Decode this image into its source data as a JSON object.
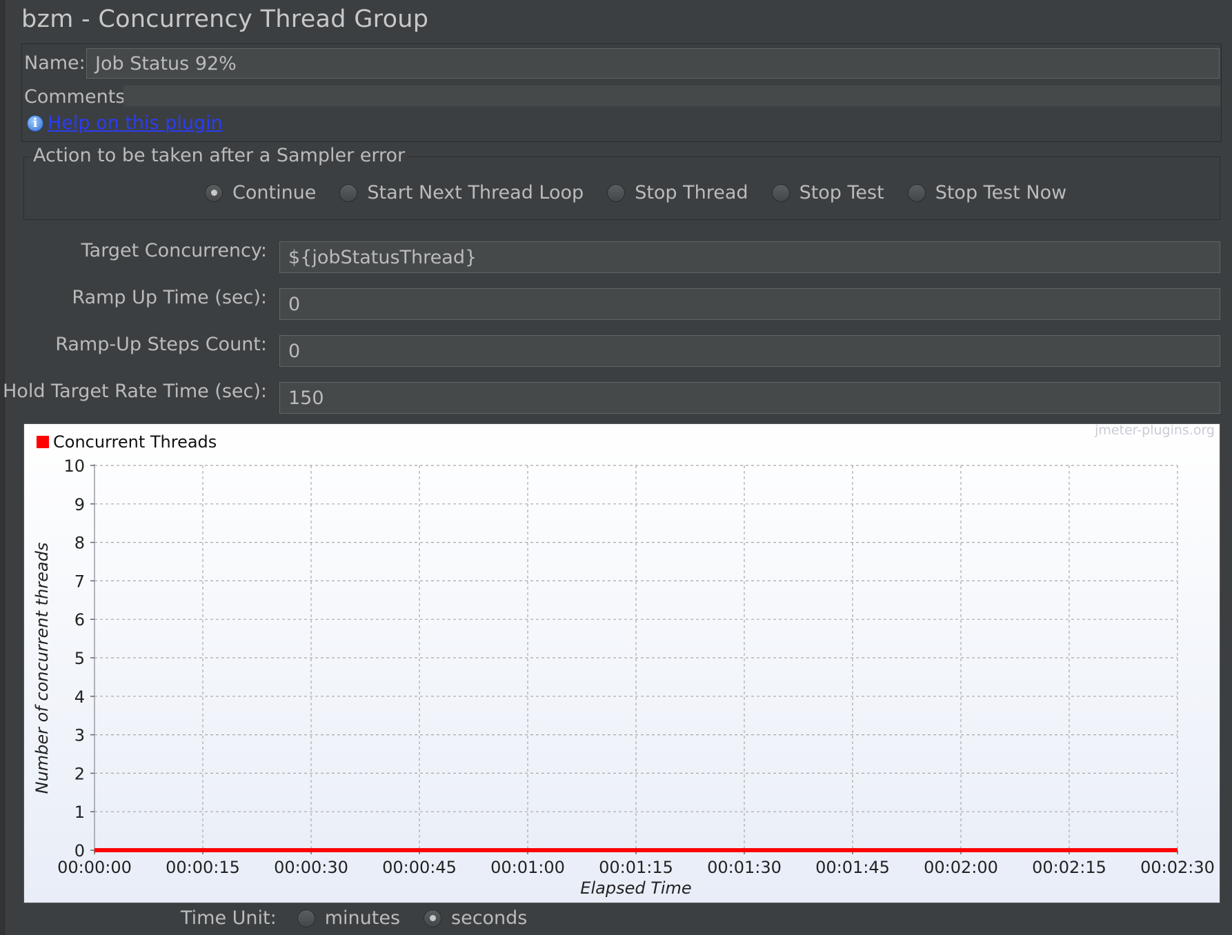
{
  "title": "bzm - Concurrency Thread Group",
  "name_label": "Name:",
  "name_value": "Job Status 92%",
  "comments_label": "Comments:",
  "comments_value": "",
  "help_link": "Help on this plugin",
  "error_action": {
    "legend": "Action to be taken after a Sampler error",
    "options": [
      "Continue",
      "Start Next Thread Loop",
      "Stop Thread",
      "Stop Test",
      "Stop Test Now"
    ],
    "selected": "Continue"
  },
  "form": {
    "target_concurrency": {
      "label": "Target Concurrency:",
      "value": "${jobStatusThread}"
    },
    "ramp_up_time": {
      "label": "Ramp Up Time (sec):",
      "value": "0"
    },
    "ramp_up_steps": {
      "label": "Ramp-Up Steps Count:",
      "value": "0"
    },
    "hold_time": {
      "label": "Hold Target Rate Time (sec):",
      "value": "150"
    }
  },
  "time_unit": {
    "label": "Time Unit:",
    "options": [
      "minutes",
      "seconds"
    ],
    "selected": "seconds"
  },
  "colors": {
    "series": "#ff0000",
    "background": "#3c3f41",
    "link": "#2a3cf5"
  },
  "chart_data": {
    "type": "line",
    "watermark": "jmeter-plugins.org",
    "legend": {
      "position": "top-left",
      "entries": [
        "Concurrent Threads"
      ]
    },
    "xlabel": "Elapsed Time",
    "ylabel": "Number of concurrent threads",
    "xticks": [
      "00:00:00",
      "00:00:15",
      "00:00:30",
      "00:00:45",
      "00:01:00",
      "00:01:15",
      "00:01:30",
      "00:01:45",
      "00:02:00",
      "00:02:15",
      "00:02:30"
    ],
    "yticks": [
      "0",
      "1",
      "2",
      "3",
      "4",
      "5",
      "6",
      "7",
      "8",
      "9",
      "10"
    ],
    "xlim": [
      0,
      150
    ],
    "ylim": [
      0,
      10
    ],
    "grid": true,
    "series": [
      {
        "name": "Concurrent Threads",
        "x": [
          0,
          150
        ],
        "y": [
          0,
          0
        ],
        "color": "#ff0000"
      }
    ]
  }
}
